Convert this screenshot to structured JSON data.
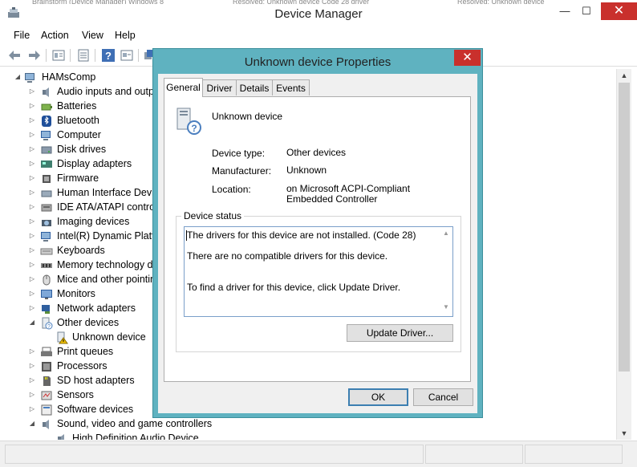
{
  "window": {
    "title": "Device Manager",
    "controls": {
      "minimize": "—",
      "maximize": "☐",
      "close": "✕"
    },
    "behind_text": [
      "Brainstorm (Device Manager) Windows 8",
      "Resolved: Unknown device Code 28 driver",
      "Resolved: Unknown device"
    ]
  },
  "menu": [
    "File",
    "Action",
    "View",
    "Help"
  ],
  "toolbar_icons": [
    "back-icon",
    "forward-icon",
    "properties-icon",
    "list-icon",
    "help-icon",
    "view-icon",
    "update-icon"
  ],
  "tree": {
    "root": "HAMsComp",
    "items": [
      {
        "label": "Audio inputs and outp",
        "icon": "speaker",
        "expander": "▷"
      },
      {
        "label": "Batteries",
        "icon": "battery",
        "expander": "▷"
      },
      {
        "label": "Bluetooth",
        "icon": "bluetooth",
        "expander": "▷"
      },
      {
        "label": "Computer",
        "icon": "computer",
        "expander": "▷"
      },
      {
        "label": "Disk drives",
        "icon": "disk",
        "expander": "▷"
      },
      {
        "label": "Display adapters",
        "icon": "display",
        "expander": "▷"
      },
      {
        "label": "Firmware",
        "icon": "firmware",
        "expander": "▷"
      },
      {
        "label": "Human Interface Devic",
        "icon": "hid",
        "expander": "▷"
      },
      {
        "label": "IDE ATA/ATAPI contro",
        "icon": "ide",
        "expander": "▷"
      },
      {
        "label": "Imaging devices",
        "icon": "camera",
        "expander": "▷"
      },
      {
        "label": "Intel(R) Dynamic Platfo",
        "icon": "computer",
        "expander": "▷"
      },
      {
        "label": "Keyboards",
        "icon": "keyboard",
        "expander": "▷"
      },
      {
        "label": "Memory technology d",
        "icon": "memory",
        "expander": "▷"
      },
      {
        "label": "Mice and other pointin",
        "icon": "mouse",
        "expander": "▷"
      },
      {
        "label": "Monitors",
        "icon": "monitor",
        "expander": "▷"
      },
      {
        "label": "Network adapters",
        "icon": "network",
        "expander": "▷"
      },
      {
        "label": "Other devices",
        "icon": "other",
        "expander": "◢"
      },
      {
        "label": "Unknown device",
        "icon": "warning",
        "expander": "",
        "child": true
      },
      {
        "label": "Print queues",
        "icon": "printer",
        "expander": "▷"
      },
      {
        "label": "Processors",
        "icon": "cpu",
        "expander": "▷"
      },
      {
        "label": "SD host adapters",
        "icon": "sd",
        "expander": "▷"
      },
      {
        "label": "Sensors",
        "icon": "sensor",
        "expander": "▷"
      },
      {
        "label": "Software devices",
        "icon": "software",
        "expander": "▷"
      },
      {
        "label": "Sound, video and game controllers",
        "icon": "speaker",
        "expander": "◢"
      },
      {
        "label": "High Definition Audio Device",
        "icon": "speaker",
        "expander": "",
        "child": true
      }
    ]
  },
  "dialog": {
    "title": "Unknown device Properties",
    "close": "✕",
    "tabs": [
      "General",
      "Driver",
      "Details",
      "Events"
    ],
    "active_tab": "General",
    "device_name": "Unknown device",
    "properties": [
      {
        "label": "Device type:",
        "value": "Other devices"
      },
      {
        "label": "Manufacturer:",
        "value": "Unknown"
      },
      {
        "label": "Location:",
        "value": "on Microsoft ACPI-Compliant Embedded Controller"
      }
    ],
    "status_group_label": "Device status",
    "status_lines": [
      "The drivers for this device are not installed. (Code 28)",
      "There are no compatible drivers for this device.",
      "To find a driver for this device, click Update Driver."
    ],
    "update_button": "Update Driver...",
    "ok_button": "OK",
    "cancel_button": "Cancel"
  },
  "colors": {
    "dialog_frame": "#5fb2c0",
    "close_red": "#c9302c",
    "focus_blue": "#3c7fb1"
  }
}
